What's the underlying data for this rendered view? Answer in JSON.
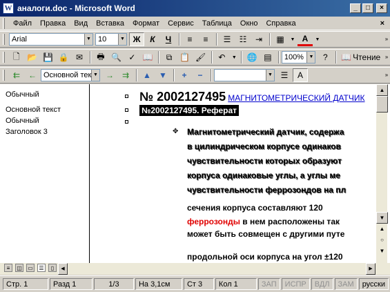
{
  "window": {
    "title": "аналоги.doc - Microsoft Word",
    "app_icon": "W",
    "buttons": [
      "_",
      "□",
      "×"
    ]
  },
  "menubar": {
    "items": [
      "Файл",
      "Правка",
      "Вид",
      "Вставка",
      "Формат",
      "Сервис",
      "Таблица",
      "Окно",
      "Справка"
    ],
    "close_glyph": "×"
  },
  "format_toolbar": {
    "font": "Arial",
    "size": "10",
    "bold": "Ж",
    "italic": "К",
    "underline": "Ч",
    "font_color_label": "A"
  },
  "standard_toolbar": {
    "zoom": "100%",
    "reading_label": "Чтение"
  },
  "outline_toolbar": {
    "style": "Основной текс"
  },
  "style_area": {
    "labels": [
      "Обычный",
      "Основной текст",
      "Обычный",
      "Заголовок 3"
    ]
  },
  "document": {
    "heading_number": "№ 2002127495",
    "heading_link": "МАГНИТОМЕТРИЧЕСКИЙ ДАТЧИК",
    "subheading": "№2002127495. Реферат",
    "lines": [
      "Магнитометрический датчик, содержа",
      "в цилиндрическом корпусе одинаков",
      "чувствительности которых образуют",
      "корпуса одинаковые углы, а углы ме",
      "чувствительности феррозондов на пл"
    ],
    "line6": "сечения корпуса составляют 120",
    "line7_red": "феррозонды",
    "line7_rest": " в нем расположены так",
    "line8": "может быть совмещен с другими путе",
    "line9": "продольной оси корпуса на угол ±120"
  },
  "statusbar": {
    "page": "Стр. 1",
    "section": "Разд  1",
    "pages": "1/3",
    "position": "На 3,1см",
    "line": "Ст  3",
    "col": "Кол  1",
    "rec": "ЗАП",
    "track": "ИСПР",
    "extend": "ВДЛ",
    "overtype": "ЗАМ",
    "language": "русски"
  },
  "icons": [
    "word-app-icon",
    "new-icon",
    "open-icon",
    "save-icon",
    "permission-icon",
    "email-icon",
    "print-icon",
    "print-preview-icon",
    "spelling-icon",
    "research-icon",
    "cut-icon",
    "copy-icon",
    "paste-icon",
    "format-painter-icon",
    "undo-icon",
    "hyperlink-icon",
    "table-icon",
    "help-icon",
    "read-icon",
    "promote-heading-icon",
    "promote-icon",
    "demote-icon",
    "demote-body-icon",
    "move-up-icon",
    "move-down-icon",
    "expand-icon",
    "collapse-icon",
    "show-formatting-icon"
  ]
}
